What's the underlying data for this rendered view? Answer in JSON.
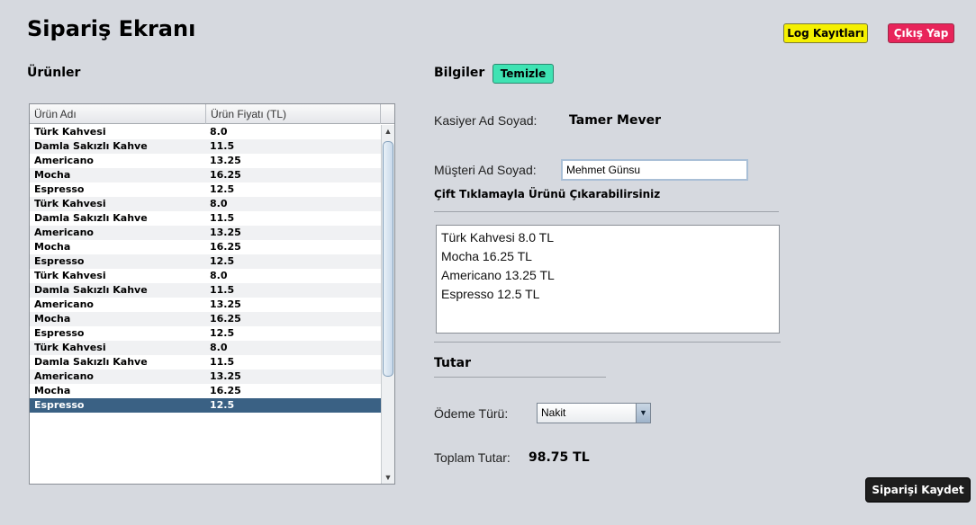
{
  "header": {
    "title": "Sipariş Ekranı",
    "log_button": "Log Kayıtları",
    "exit_button": "Çıkış Yap"
  },
  "products": {
    "heading": "Ürünler",
    "columns": [
      "Ürün Adı",
      "Ürün Fiyatı (TL)"
    ],
    "rows": [
      [
        "Türk Kahvesi",
        "8.0"
      ],
      [
        "Damla Sakızlı Kahve",
        "11.5"
      ],
      [
        "Americano",
        "13.25"
      ],
      [
        "Mocha",
        "16.25"
      ],
      [
        "Espresso",
        "12.5"
      ],
      [
        "Türk Kahvesi",
        "8.0"
      ],
      [
        "Damla Sakızlı Kahve",
        "11.5"
      ],
      [
        "Americano",
        "13.25"
      ],
      [
        "Mocha",
        "16.25"
      ],
      [
        "Espresso",
        "12.5"
      ],
      [
        "Türk Kahvesi",
        "8.0"
      ],
      [
        "Damla Sakızlı Kahve",
        "11.5"
      ],
      [
        "Americano",
        "13.25"
      ],
      [
        "Mocha",
        "16.25"
      ],
      [
        "Espresso",
        "12.5"
      ],
      [
        "Türk Kahvesi",
        "8.0"
      ],
      [
        "Damla Sakızlı Kahve",
        "11.5"
      ],
      [
        "Americano",
        "13.25"
      ],
      [
        "Mocha",
        "16.25"
      ],
      [
        "Espresso",
        "12.5"
      ]
    ],
    "selected_index": 19
  },
  "info": {
    "heading": "Bilgiler",
    "clear_button": "Temizle",
    "cashier_label": "Kasiyer Ad Soyad:",
    "cashier_value": "Tamer Mever",
    "customer_label": "Müşteri Ad Soyad:",
    "customer_value": "Mehmet Günsu",
    "hint": "Çift Tıklamayla Ürünü Çıkarabilirsiniz",
    "order_items": [
      "Türk Kahvesi  8.0 TL",
      "Mocha  16.25 TL",
      "Americano  13.25 TL",
      "Espresso  12.5 TL"
    ]
  },
  "total": {
    "heading": "Tutar",
    "payment_label": "Ödeme Türü:",
    "payment_value": "Nakit",
    "total_label": "Toplam Tutar:",
    "total_value": "98.75 TL"
  },
  "footer": {
    "save_button": "Siparişi Kaydet"
  },
  "colors": {
    "log_button_bg": "#f5f000",
    "exit_button_bg": "#e8245a",
    "clear_button_bg": "#3fe3b3",
    "selected_row_bg": "#3a6184",
    "save_button_bg": "#1e1e1e"
  }
}
